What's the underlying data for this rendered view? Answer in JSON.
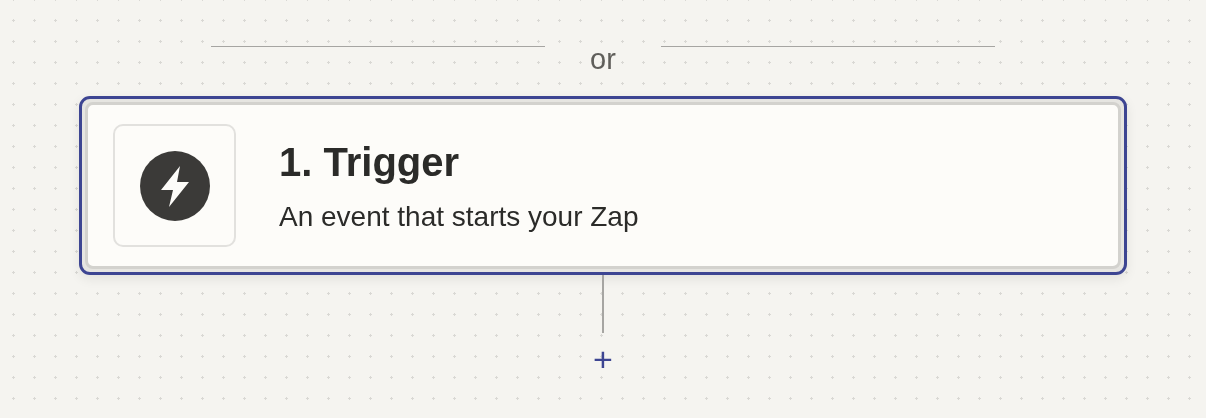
{
  "separator": {
    "label": "or"
  },
  "step": {
    "title": "1. Trigger",
    "description": "An event that starts your Zap",
    "selected": true
  },
  "add_step": {
    "label": "+"
  }
}
